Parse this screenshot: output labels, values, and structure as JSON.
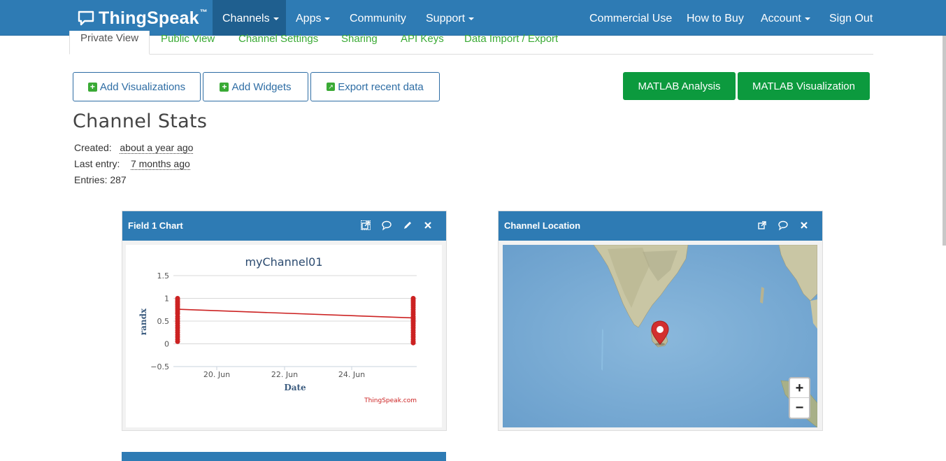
{
  "navbar": {
    "brand": "ThingSpeak",
    "brand_tm": "™",
    "left_items": [
      {
        "label": "Channels",
        "dropdown": true,
        "active": true
      },
      {
        "label": "Apps",
        "dropdown": true
      },
      {
        "label": "Community",
        "dropdown": false
      },
      {
        "label": "Support",
        "dropdown": true
      }
    ],
    "right_items": [
      {
        "label": "Commercial Use",
        "dropdown": false
      },
      {
        "label": "How to Buy",
        "dropdown": false
      },
      {
        "label": "Account",
        "dropdown": true
      },
      {
        "label": "Sign Out",
        "dropdown": false
      }
    ]
  },
  "tabs": [
    "Private View",
    "Public View",
    "Channel Settings",
    "Sharing",
    "API Keys",
    "Data Import / Export"
  ],
  "active_tab": "Private View",
  "actions": {
    "add_visualizations": "Add Visualizations",
    "add_widgets": "Add Widgets",
    "export_recent": "Export recent data",
    "matlab_analysis": "MATLAB Analysis",
    "matlab_visualization": "MATLAB Visualization"
  },
  "stats": {
    "title": "Channel Stats",
    "created_label": "Created:",
    "created_value": "about a year ago",
    "last_entry_label": "Last entry:",
    "last_entry_value": "7 months ago",
    "entries_label": "Entries:",
    "entries_value": "287"
  },
  "field_chart_widget": {
    "title": "Field 1 Chart",
    "credit": "ThingSpeak.com"
  },
  "location_widget": {
    "title": "Channel Location",
    "zoom_in": "+",
    "zoom_out": "−"
  },
  "colors": {
    "navbar": "#2e7bb4",
    "navbar_active": "#1f5f8f",
    "tab_link": "#3aaa35",
    "matlab_button": "#0c9a3e",
    "series": "#cc2222"
  },
  "chart_data": {
    "type": "line",
    "title": "myChannel01",
    "xlabel": "Date",
    "ylabel": "randx",
    "x_tick_labels": [
      "20. Jun",
      "22. Jun",
      "24. Jun"
    ],
    "y_tick_labels": [
      "1.5",
      "1",
      "0.5",
      "0",
      "−0.5"
    ],
    "ylim": [
      -0.5,
      1.5
    ],
    "grid": true,
    "series": [
      {
        "trend_line": [
          [
            0,
            0.76
          ],
          [
            1,
            0.57
          ]
        ],
        "point_clusters": [
          {
            "x": 0,
            "values": [
              1.0,
              0.97,
              0.93,
              0.9,
              0.86,
              0.82,
              0.78,
              0.74,
              0.7,
              0.66,
              0.6,
              0.55,
              0.5,
              0.45,
              0.4,
              0.35,
              0.3,
              0.25,
              0.2,
              0.15,
              0.1,
              0.05
            ]
          },
          {
            "x": 1,
            "values": [
              1.0,
              0.96,
              0.92,
              0.88,
              0.84,
              0.8,
              0.75,
              0.7,
              0.65,
              0.6,
              0.56,
              0.52,
              0.48,
              0.44,
              0.4,
              0.35,
              0.3,
              0.25,
              0.2,
              0.15,
              0.1,
              0.05,
              0.02
            ]
          }
        ]
      }
    ]
  }
}
